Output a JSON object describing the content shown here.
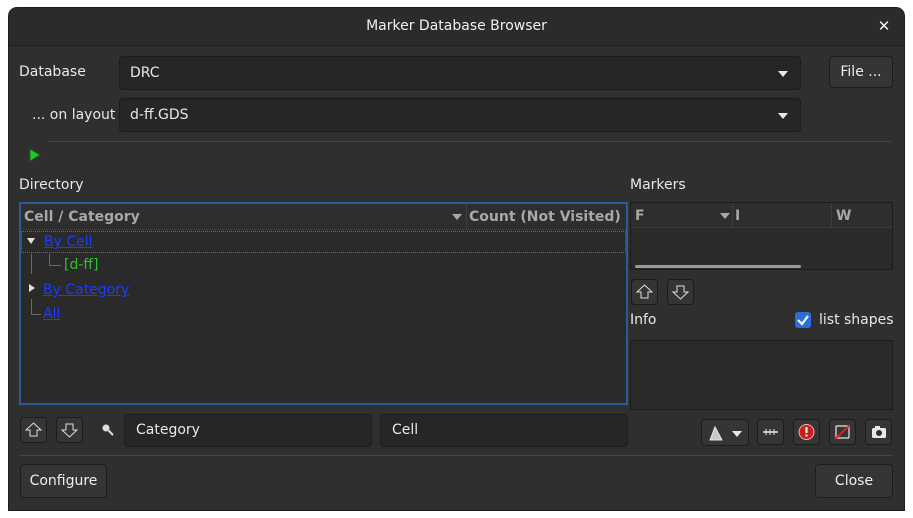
{
  "window": {
    "title": "Marker Database Browser",
    "close_glyph": "✕"
  },
  "database": {
    "label": "Database",
    "value": "DRC",
    "file_button": "File ..."
  },
  "layout": {
    "label": "... on layout",
    "value": "d-ff.GDS"
  },
  "directory": {
    "label": "Directory",
    "columns": [
      "Cell / Category",
      "Count (Not Visited)"
    ],
    "items": {
      "by_cell": "By Cell",
      "cell": "[d-ff]",
      "by_category": "By Category",
      "all": "All"
    }
  },
  "markers": {
    "label": "Markers",
    "columns": [
      "F",
      "I",
      "W"
    ]
  },
  "info": {
    "label": "Info",
    "list_shapes": "list shapes",
    "list_shapes_checked": true
  },
  "filters": {
    "category": "Category",
    "cell": "Cell"
  },
  "footer": {
    "configure": "Configure",
    "close": "Close"
  },
  "icons": [
    "run-icon",
    "up-arrow-icon",
    "down-arrow-icon",
    "search-icon",
    "marker-color-icon",
    "marker-line-icon",
    "flag-icon",
    "hide-icon",
    "snapshot-icon"
  ],
  "colors": {
    "link_blue": "#1d3cff",
    "cell_green": "#33c02e",
    "accent": "#2a6fd6"
  }
}
